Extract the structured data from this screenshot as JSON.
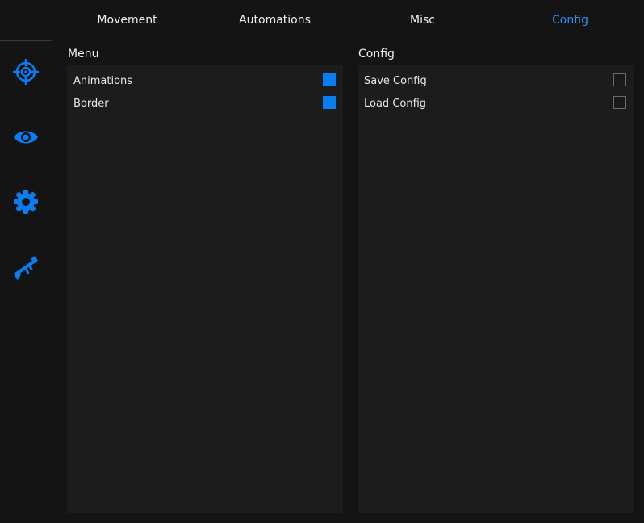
{
  "colors": {
    "accent": "#0a7df2",
    "background": "#141414",
    "panel": "#1c1c1c"
  },
  "sidebar": {
    "icons": [
      {
        "name": "crosshair-icon"
      },
      {
        "name": "eye-icon"
      },
      {
        "name": "gear-icon"
      },
      {
        "name": "rifle-icon"
      }
    ]
  },
  "tabs": [
    {
      "label": "Movement",
      "active": false
    },
    {
      "label": "Automations",
      "active": false
    },
    {
      "label": "Misc",
      "active": false
    },
    {
      "label": "Config",
      "active": true
    }
  ],
  "menu_section": {
    "title": "Menu",
    "items": [
      {
        "label": "Animations",
        "checked": true
      },
      {
        "label": "Border",
        "checked": true
      }
    ]
  },
  "config_section": {
    "title": "Config",
    "items": [
      {
        "label": "Save Config",
        "checked": false
      },
      {
        "label": "Load Config",
        "checked": false
      }
    ]
  }
}
